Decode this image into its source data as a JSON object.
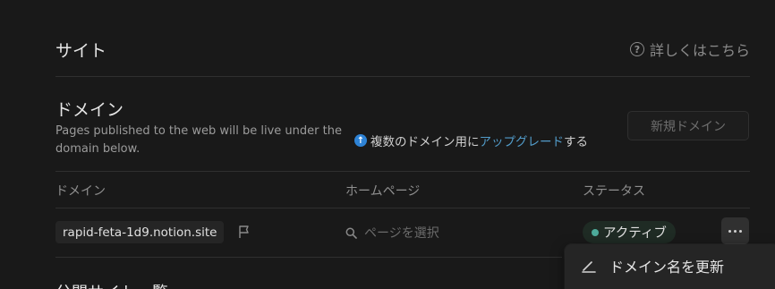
{
  "site_section": {
    "title": "サイト",
    "help_label": "詳しくはこちら"
  },
  "domain_section": {
    "title": "ドメイン",
    "description": "Pages published to the web will be live under the domain below.",
    "upgrade_note": {
      "prefix": "複数のドメイン用に",
      "link": "アップグレード",
      "suffix": "する"
    },
    "new_domain_button": "新規ドメイン"
  },
  "table": {
    "columns": [
      "ドメイン",
      "ホームページ",
      "ステータス"
    ],
    "rows": [
      {
        "domain": "rapid-feta-1d9.notion.site",
        "homepage_placeholder": "ページを選択",
        "status": "アクティブ"
      }
    ]
  },
  "context_menu": {
    "items": [
      {
        "label": "ドメイン名を更新",
        "icon": "pencil-icon"
      }
    ]
  },
  "next_section": {
    "title": "公開サイト一覧"
  },
  "colors": {
    "background": "#191919",
    "accent_link": "#529cca",
    "status_green": "#4dab9a"
  }
}
